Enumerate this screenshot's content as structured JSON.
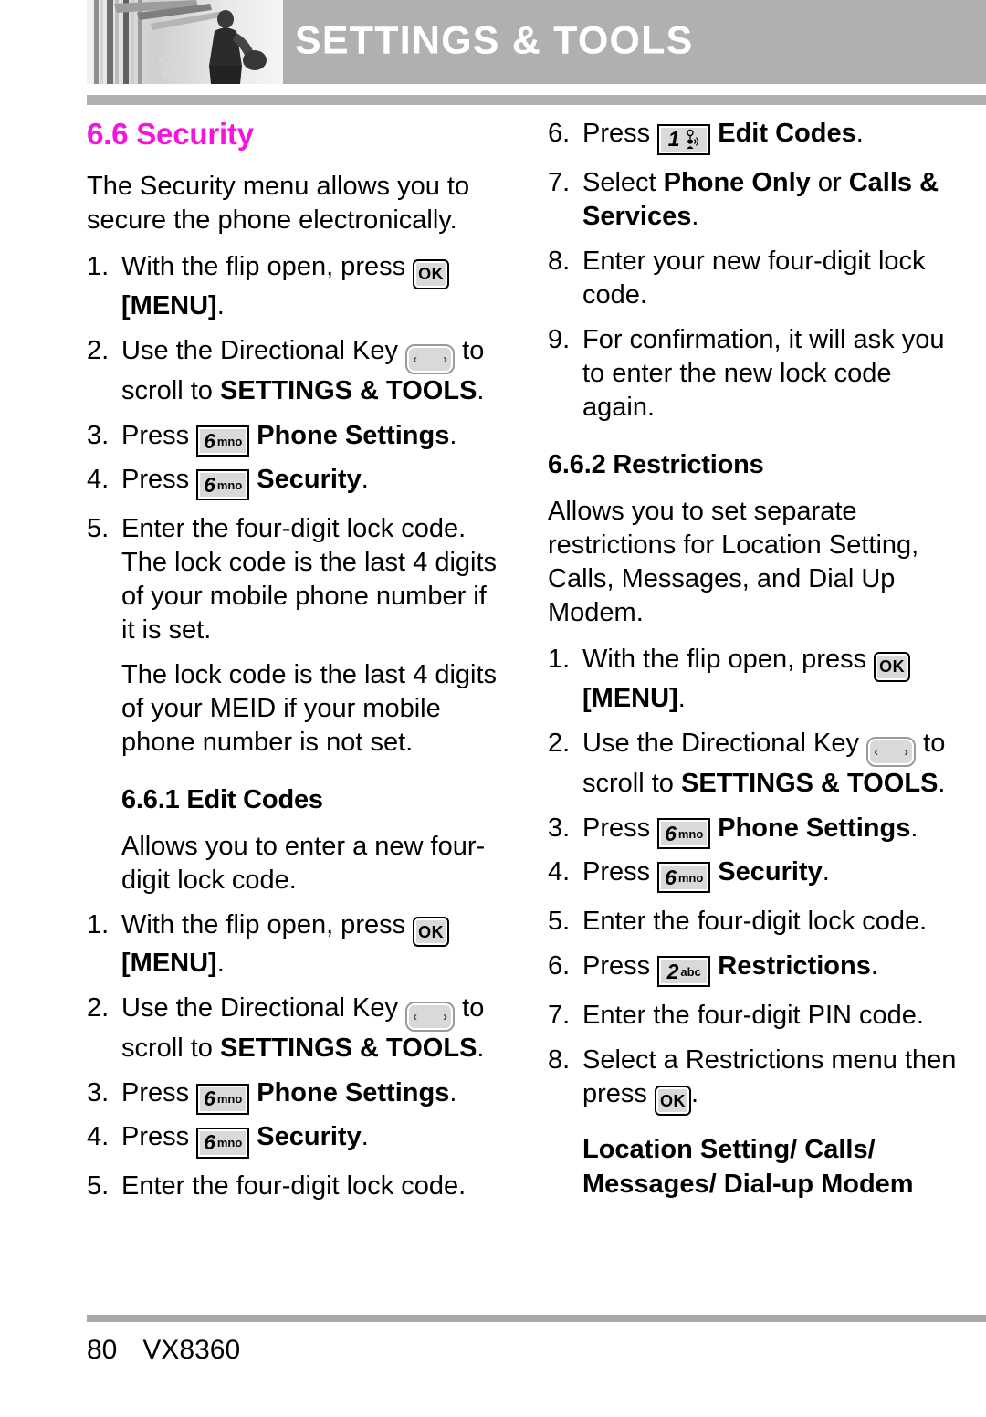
{
  "header": {
    "title": "SETTINGS & TOOLS",
    "photo_alt": "grayscale-photo-escalator-person"
  },
  "section": {
    "number_title": "6.6 Security",
    "intro": "The Security menu allows you to secure the phone electronically."
  },
  "keys": {
    "ok": "OK",
    "dir_left": "‹",
    "dir_right": "›",
    "six_digit": "6",
    "six_letters": "mno",
    "two_digit": "2",
    "two_letters": "abc",
    "one_digit": "1"
  },
  "labels": {
    "menu": "[MENU]",
    "settings_tools": "SETTINGS & TOOLS",
    "settings_amp": "SETTINGS &",
    "tools": "TOOLS",
    "phone_settings": "Phone Settings",
    "security": "Security",
    "edit_codes": "Edit Codes",
    "phone_only": "Phone Only",
    "calls_services": "Calls & Services",
    "restrictions": "Restrictions"
  },
  "left_column": {
    "steps_main": [
      {
        "num": "1.",
        "pre": "With the flip open, press ",
        "key": "ok",
        "post_bold": "[MENU]",
        "post": "."
      },
      {
        "num": "2.",
        "pre": "Use the Directional Key ",
        "key": "dir",
        "mid": " to scroll to ",
        "post_bold": "SETTINGS & TOOLS",
        "post": "."
      },
      {
        "num": "3.",
        "pre": "Press ",
        "key": "six",
        "post_bold": "Phone Settings",
        "post": "."
      },
      {
        "num": "4.",
        "pre": "Press ",
        "key": "six",
        "post_bold": "Security",
        "post": "."
      },
      {
        "num": "5.",
        "text": "Enter the four-digit lock code. The lock code is the last 4 digits of your mobile phone number if it is set."
      }
    ],
    "note": "The lock code is the last 4 digits of your MEID if your mobile phone number is not set.",
    "sub_head": "6.6.1 Edit Codes",
    "sub_intro": "Allows you to enter a new four-digit lock code.",
    "steps_sub": [
      {
        "num": "1.",
        "pre": "With the flip open, press ",
        "key": "ok",
        "post_bold": "[MENU]",
        "post": "."
      },
      {
        "num": "2.",
        "pre": "Use the Directional Key ",
        "key": "dir",
        "mid": " to scroll to ",
        "post_bold": "SETTINGS & TOOLS",
        "post": "."
      },
      {
        "num": "3.",
        "pre": "Press ",
        "key": "six",
        "post_bold": "Phone Settings",
        "post": "."
      },
      {
        "num": "4.",
        "pre": "Press ",
        "key": "six",
        "post_bold": "Security",
        "post": "."
      },
      {
        "num": "5.",
        "text": "Enter the four-digit lock code."
      }
    ]
  },
  "right_column": {
    "steps_cont": [
      {
        "num": "6.",
        "pre": "Press ",
        "key": "one",
        "post_bold": "Edit Codes",
        "post": "."
      },
      {
        "num": "7.",
        "pre": "Select ",
        "bold1": "Phone Only",
        "mid": " or ",
        "bold2": "Calls & Services",
        "post": "."
      },
      {
        "num": "8.",
        "text": "Enter your new four-digit lock code."
      },
      {
        "num": "9.",
        "text": "For confirmation, it will ask you to enter the new lock code again."
      }
    ],
    "sub_head": "6.6.2 Restrictions",
    "sub_intro": "Allows you to set separate restrictions for Location Setting, Calls, Messages, and Dial Up Modem.",
    "steps_sub": [
      {
        "num": "1.",
        "pre": "With the flip open, press ",
        "key": "ok",
        "post_bold": "[MENU]",
        "post": "."
      },
      {
        "num": "2.",
        "pre": "Use the Directional Key ",
        "key": "dir",
        "mid": " to scroll to ",
        "post_bold": "SETTINGS & TOOLS",
        "post": "."
      },
      {
        "num": "3.",
        "pre": "Press ",
        "key": "six",
        "post_bold": "Phone Settings",
        "post": "."
      },
      {
        "num": "4.",
        "pre": "Press ",
        "key": "six",
        "post_bold": "Security",
        "post": "."
      },
      {
        "num": "5.",
        "text": "Enter the four-digit lock code."
      },
      {
        "num": "6.",
        "pre": "Press ",
        "key": "two",
        "post_bold": "Restrictions",
        "post": "."
      },
      {
        "num": "7.",
        "text": "Enter the four-digit PIN code."
      },
      {
        "num": "8.",
        "pre": "Select a Restrictions menu then press ",
        "key": "ok",
        "post": "."
      }
    ],
    "menu_list_line1": "Location Setting/ Calls/",
    "menu_list_line2": "Messages/ Dial-up Modem"
  },
  "footer": {
    "page_number": "80",
    "model": "VX8360"
  },
  "colors": {
    "accent_pink": "#f912dd",
    "header_gray": "#b0b0b0",
    "key_fill": "#d9d9d9"
  }
}
